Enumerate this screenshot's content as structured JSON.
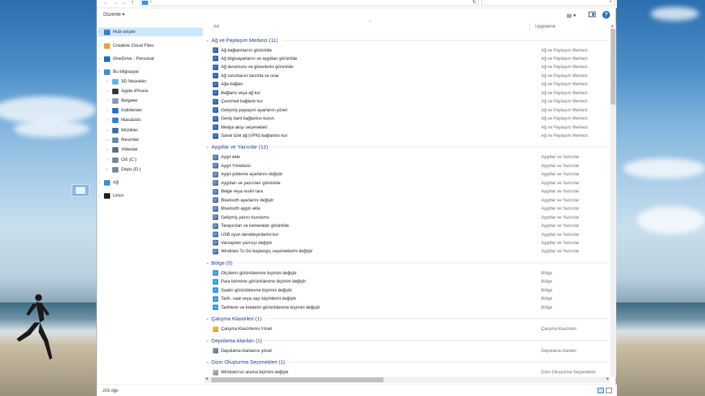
{
  "toolbar": {
    "organize_label": "Düzenle ▾"
  },
  "address": {
    "separator": "›",
    "refresh": "↻"
  },
  "search": {
    "icon": "⌕"
  },
  "help": {
    "label": "?"
  },
  "nav": {
    "items": [
      {
        "label": "Hızlı erişim",
        "icon": "star-icon",
        "color": "#3a7bd5",
        "selected": true
      },
      {
        "label": "Creative Cloud Files",
        "icon": "creative-cloud-folder-icon",
        "color": "#e8a43a"
      },
      {
        "label": "OneDrive - Personal",
        "icon": "onedrive-cloud-icon",
        "color": "#1e6fc8"
      },
      {
        "label": "Bu bilgisayar",
        "icon": "this-pc-icon",
        "color": "#3d8fd6"
      },
      {
        "label": "3D Nesneler",
        "icon": "3d-objects-icon",
        "color": "#58b6e8"
      },
      {
        "label": "Apple iPhone",
        "icon": "iphone-icon",
        "color": "#333333"
      },
      {
        "label": "Belgeler",
        "icon": "documents-icon",
        "color": "#8a9ab0"
      },
      {
        "label": "İndirilenler",
        "icon": "downloads-icon",
        "color": "#2a6fd0"
      },
      {
        "label": "Masaüstü",
        "icon": "desktop-icon",
        "color": "#2d7fd8"
      },
      {
        "label": "Müzikler",
        "icon": "music-icon",
        "color": "#3b6fb0"
      },
      {
        "label": "Resimler",
        "icon": "pictures-icon",
        "color": "#6b8aa8"
      },
      {
        "label": "Videolar",
        "icon": "videos-icon",
        "color": "#5d6f86"
      },
      {
        "label": "OS (C:)",
        "icon": "drive-c-icon",
        "color": "#7a8796"
      },
      {
        "label": "Depo (D:)",
        "icon": "drive-d-icon",
        "color": "#7a8796"
      },
      {
        "label": "Ağ",
        "icon": "network-icon",
        "color": "#3d8fd6"
      },
      {
        "label": "Linux",
        "icon": "linux-penguin-icon",
        "color": "#222222"
      }
    ]
  },
  "columns": {
    "name": "Ad",
    "app": "Uygulama",
    "sort_indicator": "^"
  },
  "groups": [
    {
      "title": "Ağ ve Paylaşım Merkezi (11)",
      "icon_class": "ic-net",
      "icon": "network-settings-icon",
      "items": [
        {
          "name": "Ağ bağlantılarını görüntüle",
          "app": "Ağ ve Paylaşım Merkezi"
        },
        {
          "name": "Ağ bilgisayarlarını ve aygıtları görüntüle",
          "app": "Ağ ve Paylaşım Merkezi"
        },
        {
          "name": "Ağ durumunu ve görevlerini görüntüle",
          "app": "Ağ ve Paylaşım Merkezi"
        },
        {
          "name": "Ağ sorunlarını tanımla ve onar",
          "app": "Ağ ve Paylaşım Merkezi"
        },
        {
          "name": "Ağa bağlan",
          "app": "Ağ ve Paylaşım Merkezi"
        },
        {
          "name": "Bağlantı veya ağ kur",
          "app": "Ağ ve Paylaşım Merkezi"
        },
        {
          "name": "Çevirmeli bağlantı kur",
          "app": "Ağ ve Paylaşım Merkezi"
        },
        {
          "name": "Gelişmiş paylaşım ayarlarını yönet",
          "app": "Ağ ve Paylaşım Merkezi"
        },
        {
          "name": "Geniş bant bağlantısı kurun",
          "app": "Ağ ve Paylaşım Merkezi"
        },
        {
          "name": "Medya akışı seçenekleri",
          "app": "Ağ ve Paylaşım Merkezi"
        },
        {
          "name": "Sanal özel ağ (VPN) bağlantısı kur",
          "app": "Ağ ve Paylaşım Merkezi"
        }
      ]
    },
    {
      "title": "Aygıtlar ve Yazıcılar (12)",
      "icon_class": "ic-dev",
      "icon": "devices-printers-icon",
      "items": [
        {
          "name": "Aygıt ekle",
          "app": "Aygıtlar ve Yazıcılar"
        },
        {
          "name": "Aygıt Yöneticisi",
          "app": "Aygıtlar ve Yazıcılar"
        },
        {
          "name": "Aygıt yükleme ayarlarını değiştir",
          "app": "Aygıtlar ve Yazıcılar"
        },
        {
          "name": "Aygıtları ve yazıcıları görüntüle",
          "app": "Aygıtlar ve Yazıcılar"
        },
        {
          "name": "Belge veya resim tara",
          "app": "Aygıtlar ve Yazıcılar"
        },
        {
          "name": "Bluetooth ayarlarını değiştir",
          "app": "Aygıtlar ve Yazıcılar"
        },
        {
          "name": "Bluetooth aygıtı ekle",
          "app": "Aygıtlar ve Yazıcılar"
        },
        {
          "name": "Gelişmiş yazıcı kurulumu",
          "app": "Aygıtlar ve Yazıcılar"
        },
        {
          "name": "Tarayıcıları ve kameraları görüntüle",
          "app": "Aygıtlar ve Yazıcılar"
        },
        {
          "name": "USB oyun denetleyicilerini kur",
          "app": "Aygıtlar ve Yazıcılar"
        },
        {
          "name": "Varsayılan yazıcıyı değiştir",
          "app": "Aygıtlar ve Yazıcılar"
        },
        {
          "name": "Windows To Go başlangıç seçeneklerini değiştir",
          "app": "Aygıtlar ve Yazıcılar"
        }
      ]
    },
    {
      "title": "Bölge (5)",
      "icon_class": "ic-region",
      "icon": "region-globe-icon",
      "items": [
        {
          "name": "Ölçülerin görüntülenme biçimini değiştir",
          "app": "Bölge"
        },
        {
          "name": "Para biriminin görüntülenme biçimini değiştir",
          "app": "Bölge"
        },
        {
          "name": "Saatin görüntülenme biçimini değiştir",
          "app": "Bölge"
        },
        {
          "name": "Tarih, saat veya sayı biçimlerini değiştir",
          "app": "Bölge"
        },
        {
          "name": "Tarihlerin ve listelerin görüntülenme biçimini değiştir",
          "app": "Bölge"
        }
      ]
    },
    {
      "title": "Çalışma Klasörleri (1)",
      "icon_class": "ic-work",
      "icon": "work-folders-icon",
      "items": [
        {
          "name": "Çalışma Klasörlerini Yönet",
          "app": "Çalışma Klasörleri"
        }
      ]
    },
    {
      "title": "Depolama Alanları (1)",
      "icon_class": "ic-storage",
      "icon": "storage-spaces-icon",
      "items": [
        {
          "name": "Depolama Alanlarını yönet",
          "app": "Depolama Alanları"
        }
      ]
    },
    {
      "title": "Dizin Oluşturma Seçenekleri (1)",
      "icon_class": "ic-index",
      "icon": "indexing-options-icon",
      "items": [
        {
          "name": "Windows'un arama biçimini değiştir",
          "app": "Dizin Oluşturma Seçenekleri"
        }
      ]
    }
  ],
  "status": {
    "count": "203 öğe"
  }
}
